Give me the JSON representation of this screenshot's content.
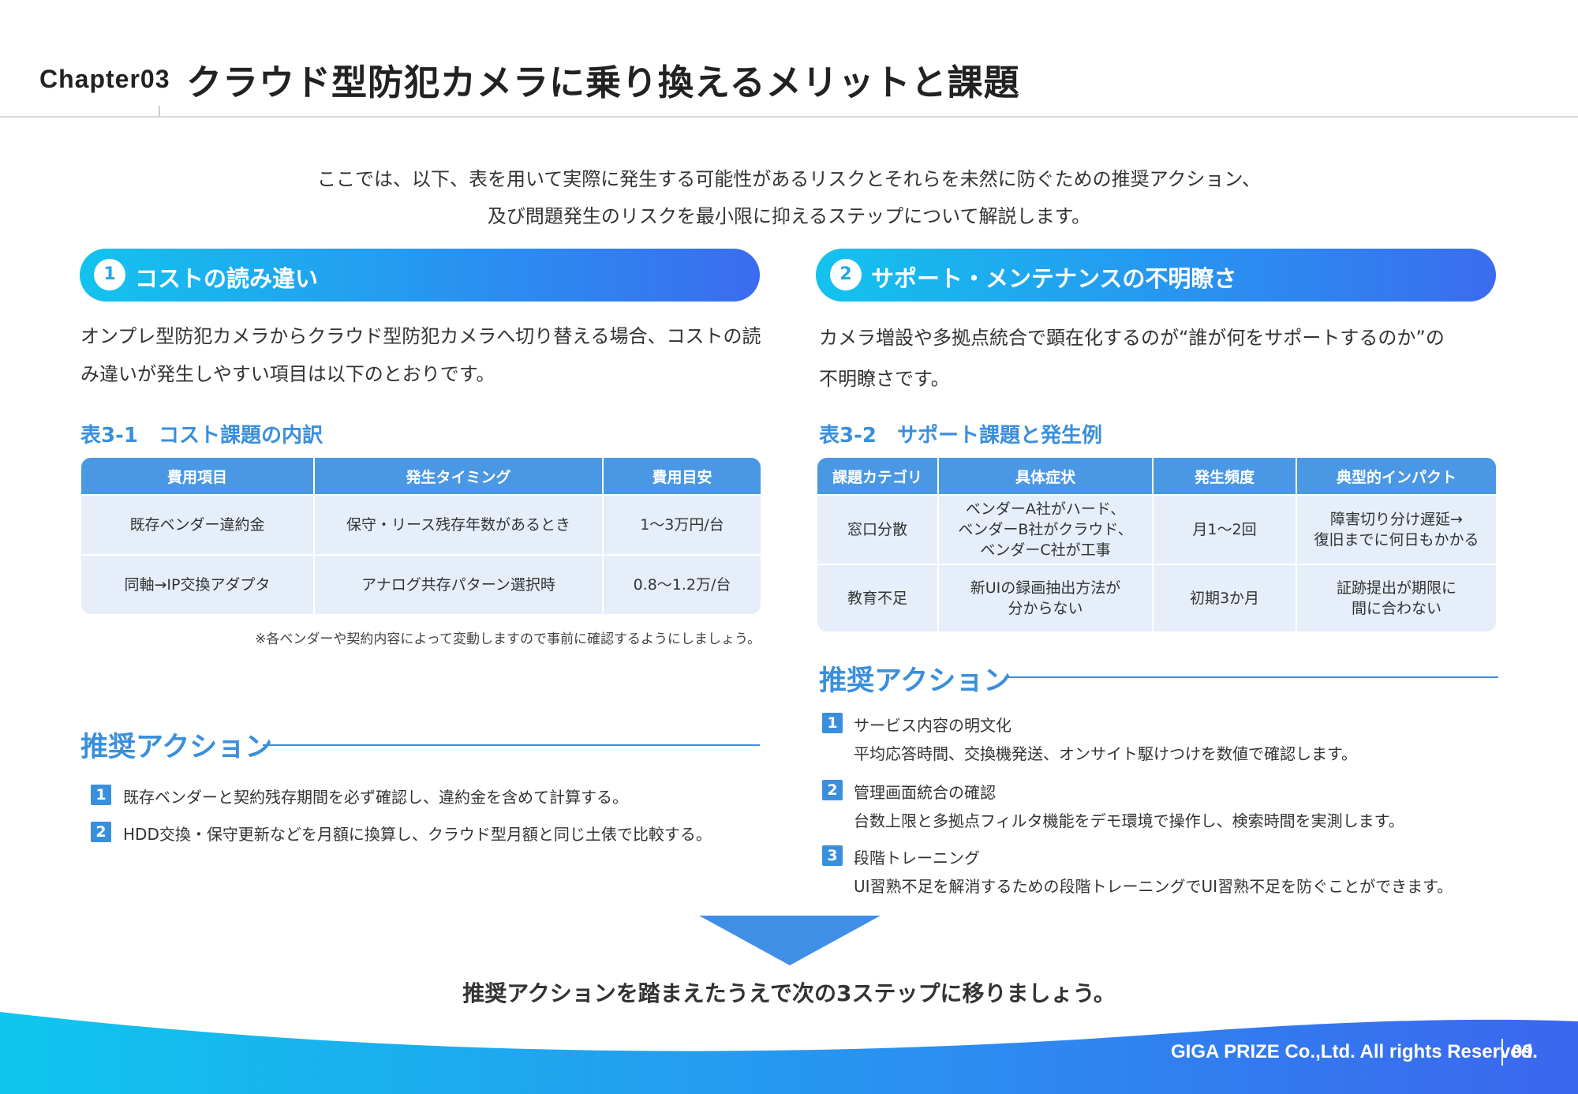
{
  "header": {
    "chapter": "Chapter03",
    "title": "クラウド型防犯カメラに乗り換えるメリットと課題"
  },
  "intro": {
    "line1": "ここでは、以下、表を用いて実際に発生する可能性があるリスクとそれらを未然に防ぐための推奨アクション、",
    "line2": "及び問題発生のリスクを最小限に抑えるステップについて解説します。"
  },
  "left": {
    "num": "1",
    "title": "コストの読み違い",
    "paragraph": "オンプレ型防犯カメラからクラウド型防犯カメラへ切り替える場合、コストの読み違いが発生しやすい項目は以下のとおりです。",
    "table_caption": "表3-1　コスト課題の内訳",
    "table": {
      "headers": [
        "費用項目",
        "発生タイミング",
        "費用目安"
      ],
      "rows": [
        [
          "既存ベンダー違約金",
          "保守・リース残存年数があるとき",
          "1～3万円/台"
        ],
        [
          "同軸→IP交換アダプタ",
          "アナログ共存パターン選択時",
          "0.8～1.2万/台"
        ]
      ]
    },
    "note": "※各ベンダーや契約内容によって変動しますので事前に確認するようにしましょう。",
    "rec_title": "推奨アクション",
    "actions": [
      {
        "num": "1",
        "text": "既存ベンダーと契約残存期間を必ず確認し、違約金を含めて計算する。"
      },
      {
        "num": "2",
        "text": "HDD交換・保守更新などを月額に換算し、クラウド型月額と同じ土俵で比較する。"
      }
    ]
  },
  "right": {
    "num": "2",
    "title": "サポート・メンテナンスの不明瞭さ",
    "paragraph_line1": "カメラ増設や多拠点統合で顕在化するのが“誰が何をサポートするのか”の",
    "paragraph_line2": "不明瞭さです。",
    "table_caption": "表3-2　サポート課題と発生例",
    "table": {
      "headers": [
        "課題カテゴリ",
        "具体症状",
        "発生頻度",
        "典型的インパクト"
      ],
      "rows": [
        [
          "窓口分散",
          [
            "ベンダーA社がハード、",
            "ベンダーB社がクラウド、",
            "ベンダーC社が工事"
          ],
          "月1～2回",
          [
            "障害切り分け遅延→",
            "復旧までに何日もかかる"
          ]
        ],
        [
          "教育不足",
          [
            "新UIの録画抽出方法が",
            "分からない"
          ],
          "初期3か月",
          [
            "証跡提出が期限に",
            "間に合わない"
          ]
        ]
      ]
    },
    "rec_title": "推奨アクション",
    "actions": [
      {
        "num": "1",
        "title": "サービス内容の明文化",
        "desc": "平均応答時間、交換機発送、オンサイト駆けつけを数値で確認します。"
      },
      {
        "num": "2",
        "title": "管理画面統合の確認",
        "desc": "台数上限と多拠点フィルタ機能をデモ環境で操作し、検索時間を実測します。"
      },
      {
        "num": "3",
        "title": "段階トレーニング",
        "desc": "UI習熟不足を解消するための段階トレーニングでUI習熟不足を防ぐことができます。"
      }
    ]
  },
  "conclusion": "推奨アクションを踏まえたうえで次の3ステップに移りましょう。",
  "footer": {
    "copyright": "GIGA PRIZE Co.,Ltd. All rights Reserved.",
    "page": "09"
  },
  "colors": {
    "accent": "#3a8fdc",
    "banner_start": "#13c3ee",
    "banner_end": "#3a6cf0",
    "table_header": "#4a98e4",
    "table_cell": "#e6eefa"
  }
}
